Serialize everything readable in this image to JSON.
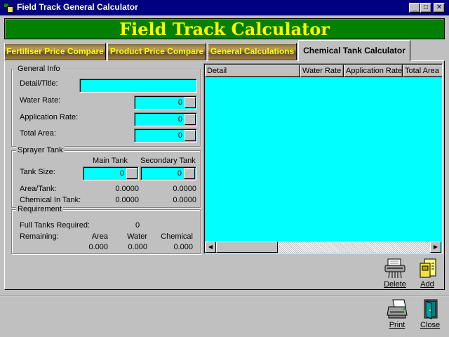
{
  "window": {
    "title": "Field Track General Calculator",
    "controls": {
      "minimize": "_",
      "maximize": "□",
      "close": "✕"
    }
  },
  "banner": {
    "title": "Field Track Calculator"
  },
  "tabs": [
    {
      "label": "Fertiliser Price Compare"
    },
    {
      "label": "Product Price Compare"
    },
    {
      "label": "General Calculations"
    },
    {
      "label": "Chemical Tank Calculator"
    }
  ],
  "general_info": {
    "legend": "General Info",
    "detail_label": "Detail/Title:",
    "detail_value": "",
    "water_rate_label": "Water Rate:",
    "water_rate_value": "0",
    "application_rate_label": "Application Rate:",
    "application_rate_value": "0",
    "total_area_label": "Total Area:",
    "total_area_value": "0"
  },
  "sprayer_tank": {
    "legend": "Sprayer Tank",
    "main_tank_header": "Main Tank",
    "secondary_tank_header": "Secondary Tank",
    "tank_size_label": "Tank Size:",
    "main_tank_size": "0",
    "secondary_tank_size": "0",
    "area_tank_label": "Area/Tank:",
    "main_area_tank": "0.0000",
    "secondary_area_tank": "0.0000",
    "chemical_in_tank_label": "Chemical In Tank:",
    "main_chemical": "0.0000",
    "secondary_chemical": "0.0000"
  },
  "requirement": {
    "legend": "Requirement",
    "full_tanks_label": "Full Tanks Required:",
    "full_tanks_value": "0",
    "remaining_label": "Remaining:",
    "area_header": "Area",
    "water_header": "Water",
    "chemical_header": "Chemical",
    "area_value": "0.000",
    "water_value": "0.000",
    "chemical_value": "0.000"
  },
  "list": {
    "columns": [
      "Detail",
      "Water Rate",
      "Application Rate",
      "Total Area"
    ],
    "rows": []
  },
  "buttons": {
    "delete": "Delete",
    "add": "Add",
    "print": "Print",
    "close": "Close"
  },
  "icons": {
    "app": "app-icon",
    "delete": "shredder-icon",
    "add": "add-document-icon",
    "print": "printer-icon",
    "close": "exit-door-icon"
  },
  "colors": {
    "title_bar": "#000080",
    "banner_bg": "#008000",
    "banner_text": "#ffff00",
    "input_bg": "#00ffff",
    "face": "#c0c0c0"
  }
}
